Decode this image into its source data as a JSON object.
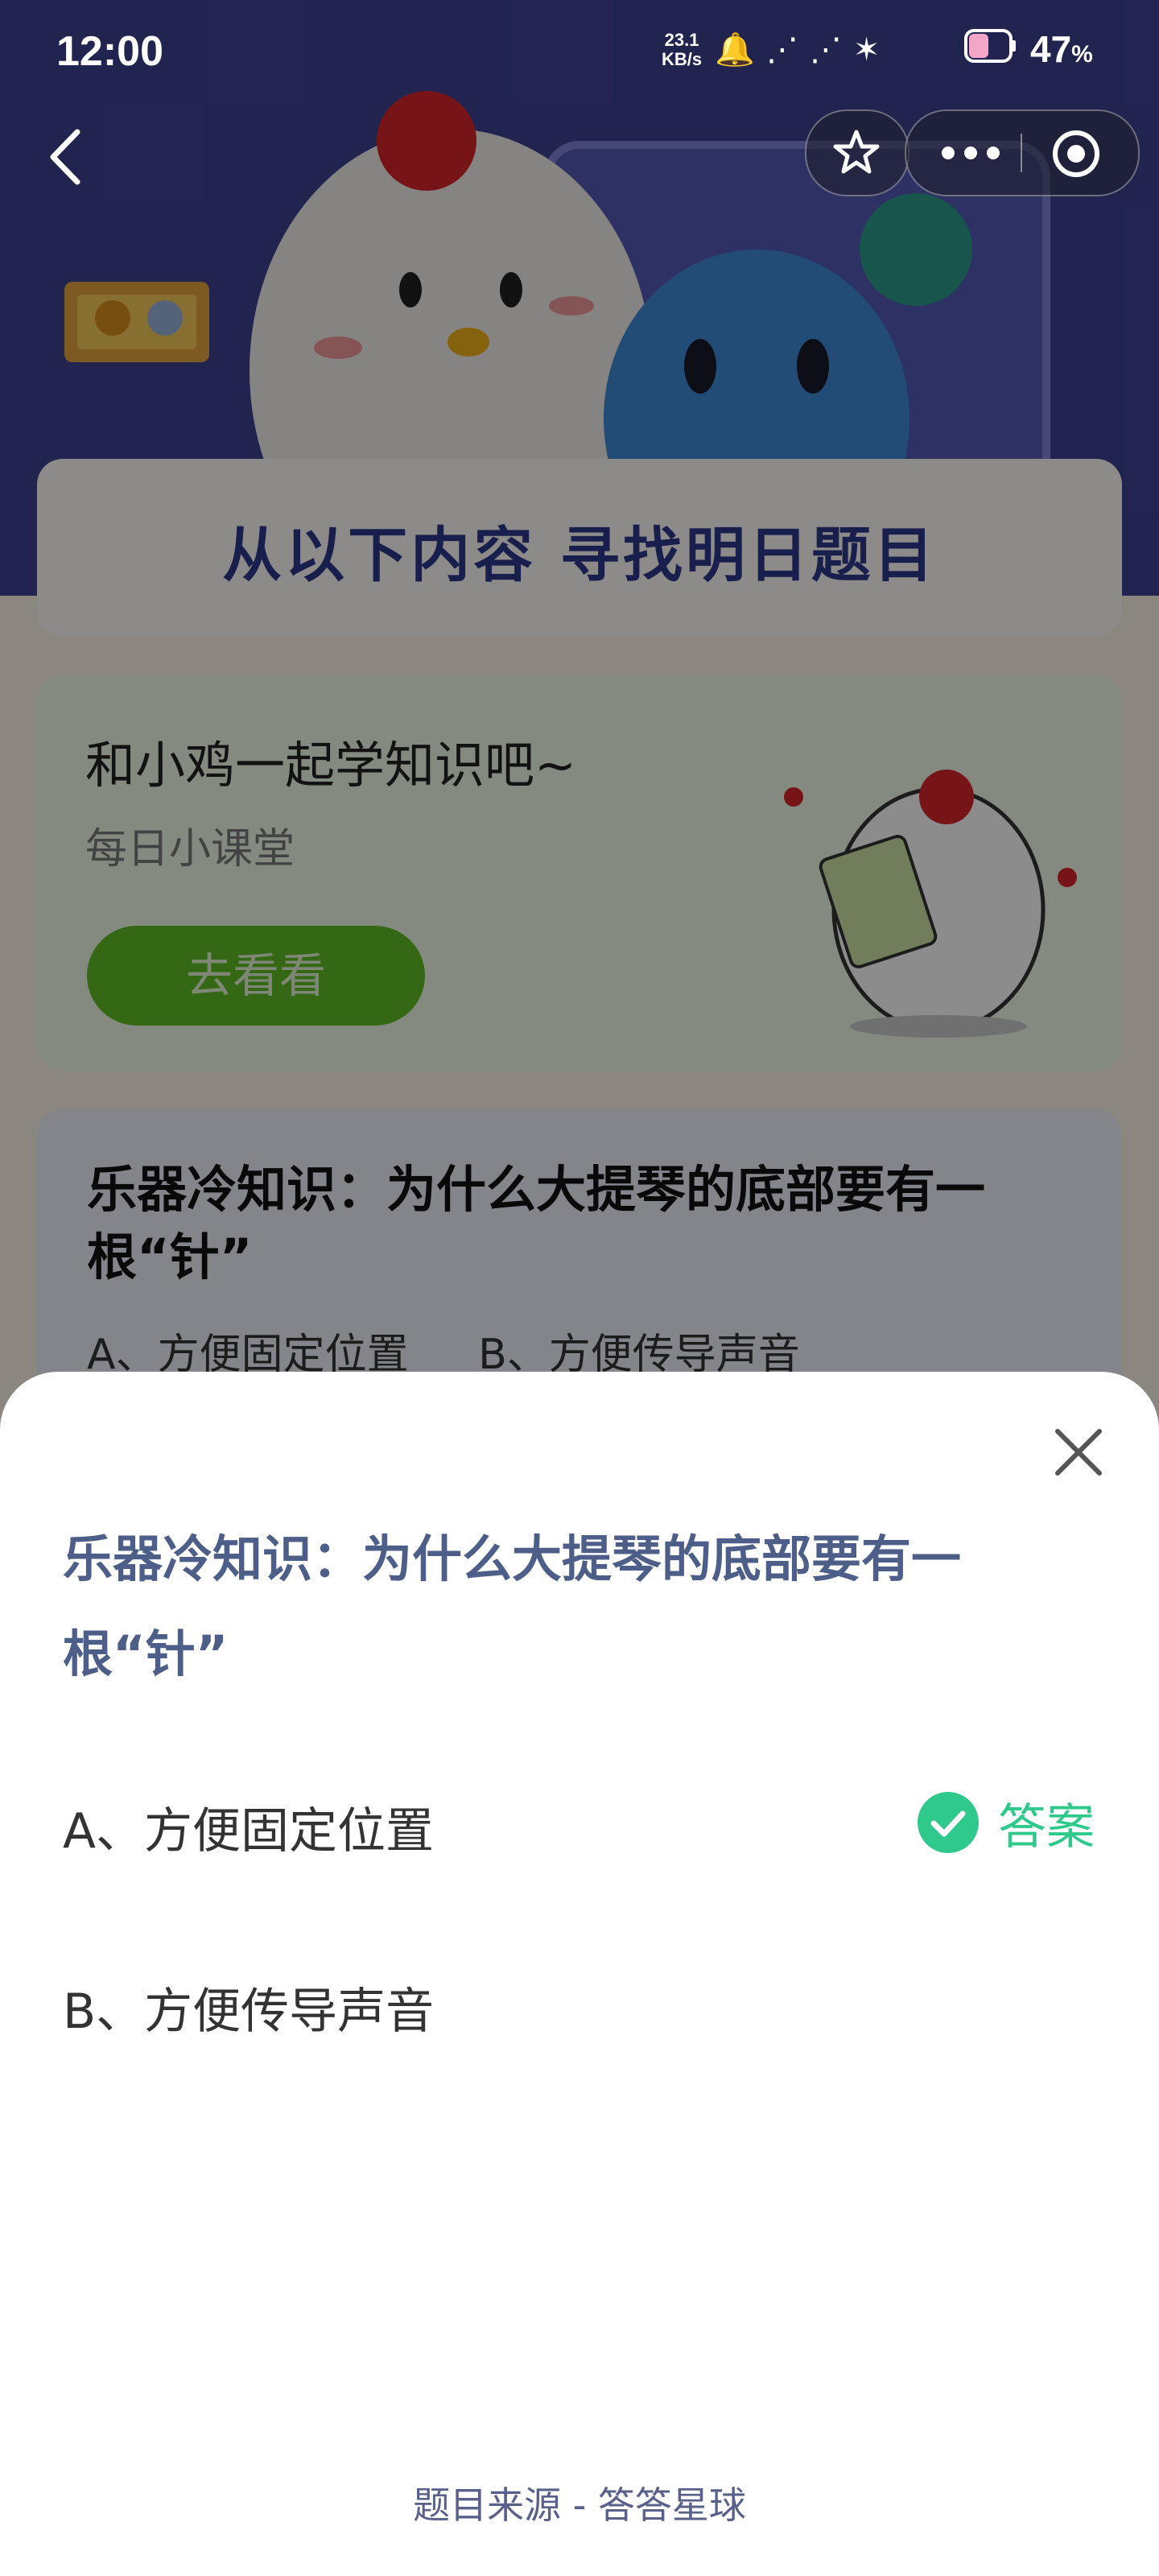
{
  "status_bar": {
    "time": "12:00",
    "net_speed_value": "23.1",
    "net_speed_unit": "KB/s",
    "battery_percent": "47",
    "battery_suffix": "%"
  },
  "nav": {
    "back_icon": "chevron-left-icon",
    "star_icon": "star-icon",
    "more_icon": "more-dots-icon",
    "target_icon": "target-icon"
  },
  "background": {
    "section_header": "从以下内容  寻找明日题目",
    "learn_card": {
      "title": "和小鸡一起学知识吧~",
      "subtitle": "每日小课堂",
      "button": "去看看"
    },
    "quiz_card": {
      "question": "乐器冷知识：为什么大提琴的底部要有一根“针”",
      "option_a": "A、方便固定位置",
      "option_b": "B、方便传导声音"
    }
  },
  "sheet": {
    "question": "乐器冷知识：为什么大提琴的底部要有一根“针”",
    "options": [
      {
        "label": "A、方便固定位置",
        "is_answer": true
      },
      {
        "label": "B、方便传导声音",
        "is_answer": false
      }
    ],
    "answer_tag": "答案",
    "source": "题目来源 - 答答星球"
  },
  "colors": {
    "answer_green": "#2fc98b",
    "question_blue": "#4d5f88",
    "button_green": "#5fbd27"
  }
}
